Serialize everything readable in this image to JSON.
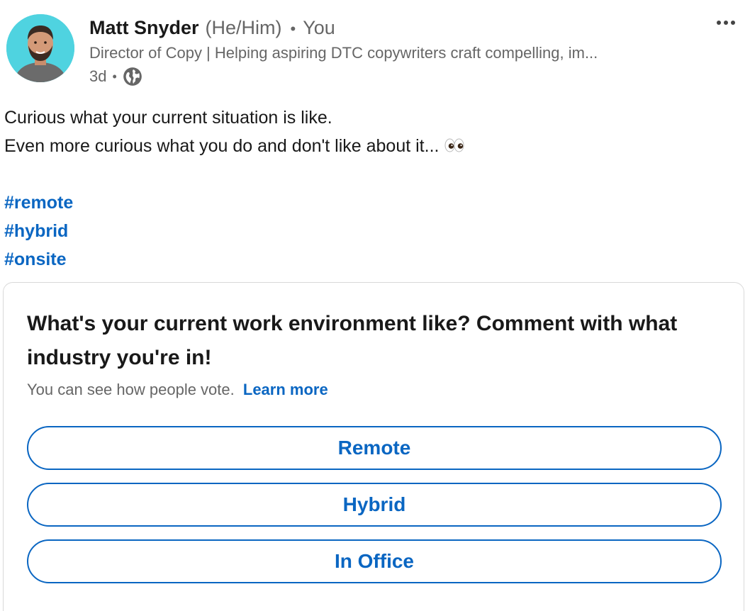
{
  "post": {
    "author": {
      "name": "Matt Snyder",
      "pronouns": "(He/Him)",
      "separator": "•",
      "relation": "You",
      "headline": "Director of Copy | Helping aspiring DTC copywriters craft compelling, im...",
      "time": "3d",
      "meta_separator": "•",
      "visibility_icon": "globe-icon",
      "avatar_color": "#4fd3e0"
    },
    "text_lines": [
      "Curious what your current situation is like.",
      "Even more curious what you do and don't like about it..."
    ],
    "hashtags": [
      "#remote",
      "#hybrid",
      "#onsite"
    ]
  },
  "poll": {
    "question": "What's your current work environment like? Comment with what industry you're in!",
    "note": "You can see how people vote.",
    "learn_more": "Learn more",
    "options": [
      "Remote",
      "Hybrid",
      "In Office"
    ]
  },
  "colors": {
    "accent": "#0a66c2",
    "muted_text": "#666666",
    "text": "#191919",
    "border": "#d9d9d9"
  }
}
